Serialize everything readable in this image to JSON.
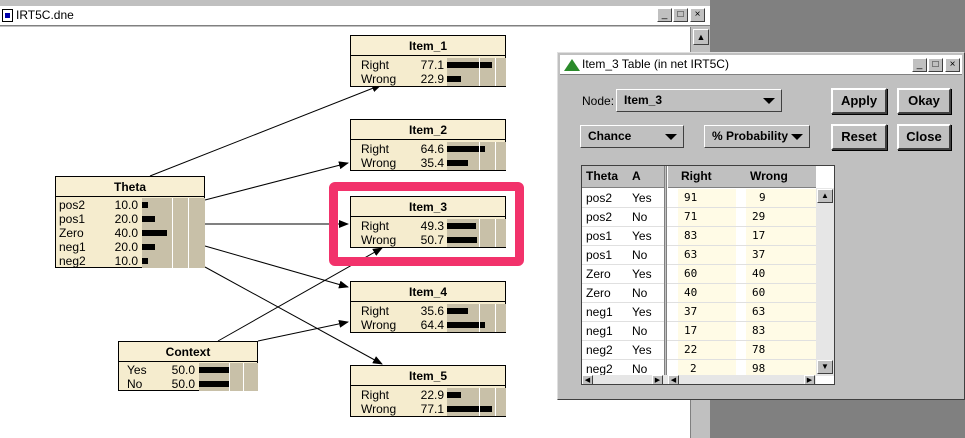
{
  "main_window": {
    "title": "IRT5C.dne",
    "controls": [
      "_",
      "□",
      "×"
    ]
  },
  "nodes": {
    "item1": {
      "title": "Item_1",
      "states": [
        {
          "name": "Right",
          "value": "77.1",
          "pct": 77.1
        },
        {
          "name": "Wrong",
          "value": "22.9",
          "pct": 22.9
        }
      ]
    },
    "item2": {
      "title": "Item_2",
      "states": [
        {
          "name": "Right",
          "value": "64.6",
          "pct": 64.6
        },
        {
          "name": "Wrong",
          "value": "35.4",
          "pct": 35.4
        }
      ]
    },
    "item3": {
      "title": "Item_3",
      "states": [
        {
          "name": "Right",
          "value": "49.3",
          "pct": 49.3
        },
        {
          "name": "Wrong",
          "value": "50.7",
          "pct": 50.7
        }
      ]
    },
    "item4": {
      "title": "Item_4",
      "states": [
        {
          "name": "Right",
          "value": "35.6",
          "pct": 35.6
        },
        {
          "name": "Wrong",
          "value": "64.4",
          "pct": 64.4
        }
      ]
    },
    "item5": {
      "title": "Item_5",
      "states": [
        {
          "name": "Right",
          "value": "22.9",
          "pct": 22.9
        },
        {
          "name": "Wrong",
          "value": "77.1",
          "pct": 77.1
        }
      ]
    },
    "theta": {
      "title": "Theta",
      "states": [
        {
          "name": "pos2",
          "value": "10.0",
          "pct": 10
        },
        {
          "name": "pos1",
          "value": "20.0",
          "pct": 20
        },
        {
          "name": "Zero",
          "value": "40.0",
          "pct": 40
        },
        {
          "name": "neg1",
          "value": "20.0",
          "pct": 20
        },
        {
          "name": "neg2",
          "value": "10.0",
          "pct": 10
        }
      ]
    },
    "context": {
      "title": "Context",
      "states": [
        {
          "name": "Yes",
          "value": "50.0",
          "pct": 50
        },
        {
          "name": "No",
          "value": "50.0",
          "pct": 50
        }
      ]
    }
  },
  "dialog": {
    "title": "Item_3 Table (in net IRT5C)",
    "controls": [
      "_",
      "□",
      "×"
    ],
    "node_label": "Node:",
    "node_value": "Item_3",
    "chance_value": "Chance",
    "prob_value": "% Probability",
    "buttons": {
      "apply": "Apply",
      "okay": "Okay",
      "reset": "Reset",
      "close": "Close"
    },
    "table": {
      "headers": [
        "Theta",
        "A",
        "Right",
        "Wrong"
      ],
      "rows": [
        [
          "pos2",
          "Yes",
          "91",
          "9"
        ],
        [
          "pos2",
          "No",
          "71",
          "29"
        ],
        [
          "pos1",
          "Yes",
          "83",
          "17"
        ],
        [
          "pos1",
          "No",
          "63",
          "37"
        ],
        [
          "Zero",
          "Yes",
          "60",
          "40"
        ],
        [
          "Zero",
          "No",
          "40",
          "60"
        ],
        [
          "neg1",
          "Yes",
          "37",
          "63"
        ],
        [
          "neg1",
          "No",
          "17",
          "83"
        ],
        [
          "neg2",
          "Yes",
          "22",
          "78"
        ],
        [
          "neg2",
          "No",
          "2",
          "98"
        ]
      ]
    }
  },
  "colors": {
    "highlight": "#f2326b",
    "node_fill": "#f5ecce"
  }
}
